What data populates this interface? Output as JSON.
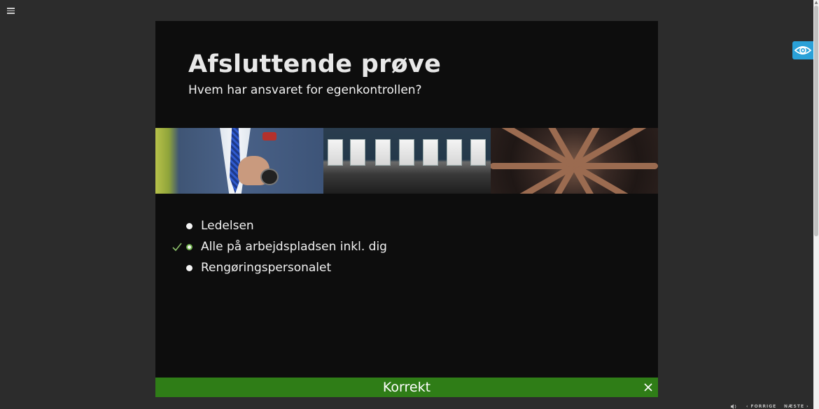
{
  "slide": {
    "title": "Afsluttende prøve",
    "question": "Hvem har ansvaret for egenkontrollen?"
  },
  "answers": [
    {
      "text": "Ledelsen",
      "selected": false,
      "correct": false
    },
    {
      "text": "Alle på arbejdspladsen inkl. dig",
      "selected": true,
      "correct": true
    },
    {
      "text": "Rengøringspersonalet",
      "selected": false,
      "correct": false
    }
  ],
  "feedback": {
    "text": "Korrekt",
    "color": "#2f7d17"
  },
  "navigation": {
    "prev_label": "‹ FORRIGE",
    "next_label": "NÆSTE ›"
  },
  "icons": {
    "menu": "hamburger-menu-icon",
    "eye": "eye-icon",
    "close": "close-icon",
    "check": "checkmark-icon",
    "speaker": "speaker-icon"
  },
  "colors": {
    "background": "#2c2c2c",
    "slide": "#0d0d0d",
    "accent_eye": "#2aa1d8",
    "correct": "#6fb24a"
  }
}
